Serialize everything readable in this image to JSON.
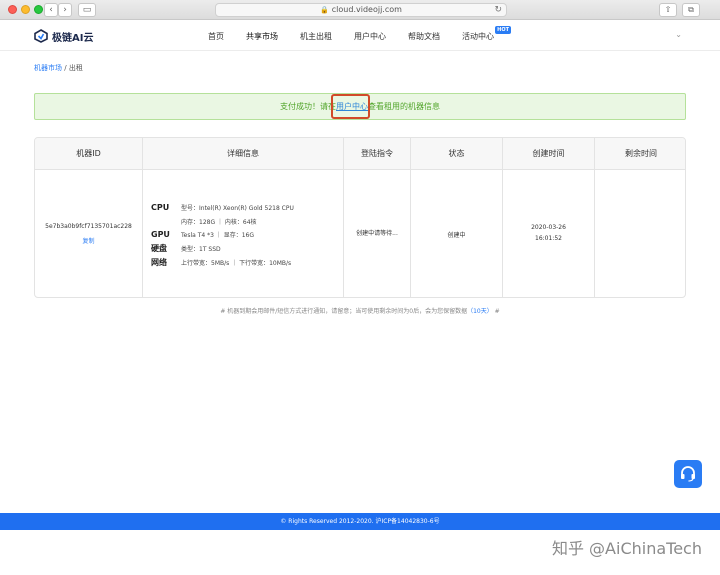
{
  "browser": {
    "url": "cloud.videojj.com",
    "back_glyph": "‹",
    "forward_glyph": "›",
    "sidebar_glyph": "▭",
    "reload_glyph": "↻",
    "lock_glyph": "🔒",
    "share_glyph": "⇧",
    "tabs_glyph": "⧉"
  },
  "header": {
    "brand": "极链AI云",
    "nav": [
      {
        "label": "首页"
      },
      {
        "label": "共享市场"
      },
      {
        "label": "机主出租"
      },
      {
        "label": "用户中心"
      },
      {
        "label": "帮助文档"
      },
      {
        "label": "活动中心",
        "badge": "HOT"
      }
    ],
    "chevron": "⌄"
  },
  "breadcrumb": {
    "root": "机器市场",
    "sep": "/",
    "current": "出租"
  },
  "banner": {
    "prefix": "支付成功！请在",
    "link": "用户中心",
    "suffix": "查看租用的机器信息"
  },
  "table": {
    "headers": [
      "机器ID",
      "详细信息",
      "登陆指令",
      "状态",
      "创建时间",
      "剩余时间"
    ],
    "row": {
      "machine_id": "5e7b3a0b9fcf7135701ac228",
      "copy_label": "复制",
      "cpu_label": "CPU",
      "cpu_model": "型号：Intel(R) Xeon(R) Gold 5218 CPU",
      "cpu_mem": "内存：128G ｜ 内核：64核",
      "gpu_label": "GPU",
      "gpu_info": "Tesla T4 *3 ｜ 显存：16G",
      "disk_label": "硬盘",
      "disk_info": "类型：1T SSD",
      "net_label": "网络",
      "net_info": "上行带宽：5MB/s ｜ 下行带宽：10MB/s",
      "login_cmd": "创建中请等待...",
      "status": "创建中",
      "created_date": "2020-03-26",
      "created_time": "16:01:52",
      "remaining": ""
    }
  },
  "note": {
    "prefix": "# 机器到期会用邮件/短信方式进行通知，请留意；当可使用剩余时间为0后，会为您保留数据",
    "days": "（10天）",
    "suffix": " #"
  },
  "footer": {
    "text": "© Rights Reserved 2012-2020. 沪ICP备14042830-6号"
  },
  "watermark": "知乎 @AiChinaTech",
  "colors": {
    "accent": "#2a7cf4",
    "success_bg": "#eaf7e3",
    "success_text": "#52a52b",
    "highlight": "#d14a29",
    "footer": "#1f6ff0"
  }
}
